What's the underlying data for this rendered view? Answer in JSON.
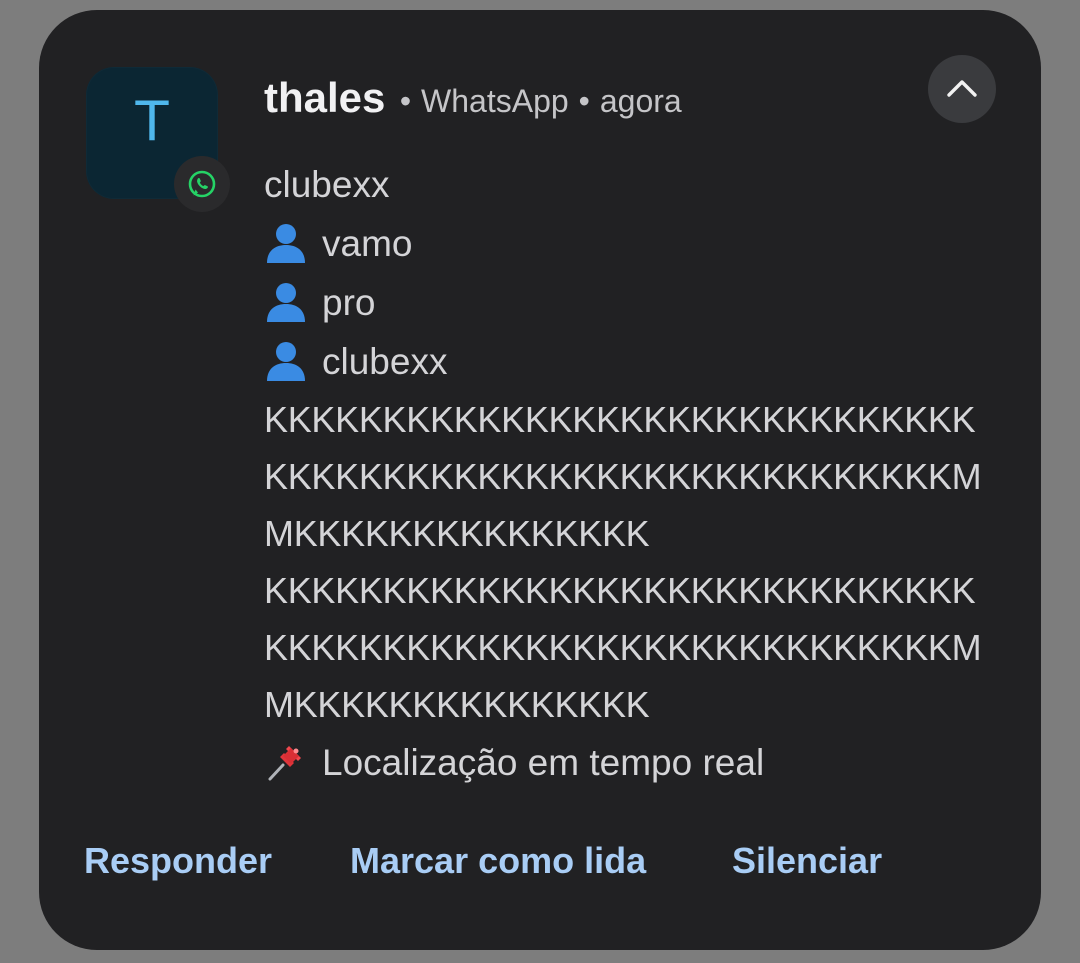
{
  "notification": {
    "app_icon": "whatsapp-icon",
    "avatar_letter": "T",
    "sender": "thales",
    "app": "WhatsApp",
    "time": "agora",
    "separator": "•",
    "collapse_icon": "chevron-up-icon",
    "lines": [
      {
        "text": "clubexx",
        "icon": null
      },
      {
        "text": "vamo",
        "icon": "person-icon"
      },
      {
        "text": "pro",
        "icon": "person-icon"
      },
      {
        "text": "clubexx",
        "icon": "person-icon"
      }
    ],
    "k_lines": [
      "KKKKKKKKKKKKKKKKKKKKKKKKKKKKKK",
      "KKKKKKKKKKKKKKKKKKKKKKKKKKKKKM",
      "MKKKKKKKKKKKKKKK",
      "KKKKKKKKKKKKKKKKKKKKKKKKKKKKKK",
      "KKKKKKKKKKKKKKKKKKKKKKKKKKKKKM",
      "MKKKKKKKKKKKKKKK"
    ],
    "location_line": {
      "text": "Localização em tempo real",
      "icon": "pushpin-icon"
    },
    "actions": {
      "reply": "Responder",
      "mark_read": "Marcar como lida",
      "mute": "Silenciar"
    }
  },
  "colors": {
    "background": "#7d7d7d",
    "card": "#212123",
    "action_text": "#a9cdf5",
    "avatar_bg": "#0b2633",
    "avatar_letter": "#4fb7ec",
    "whatsapp_green": "#25d366"
  }
}
